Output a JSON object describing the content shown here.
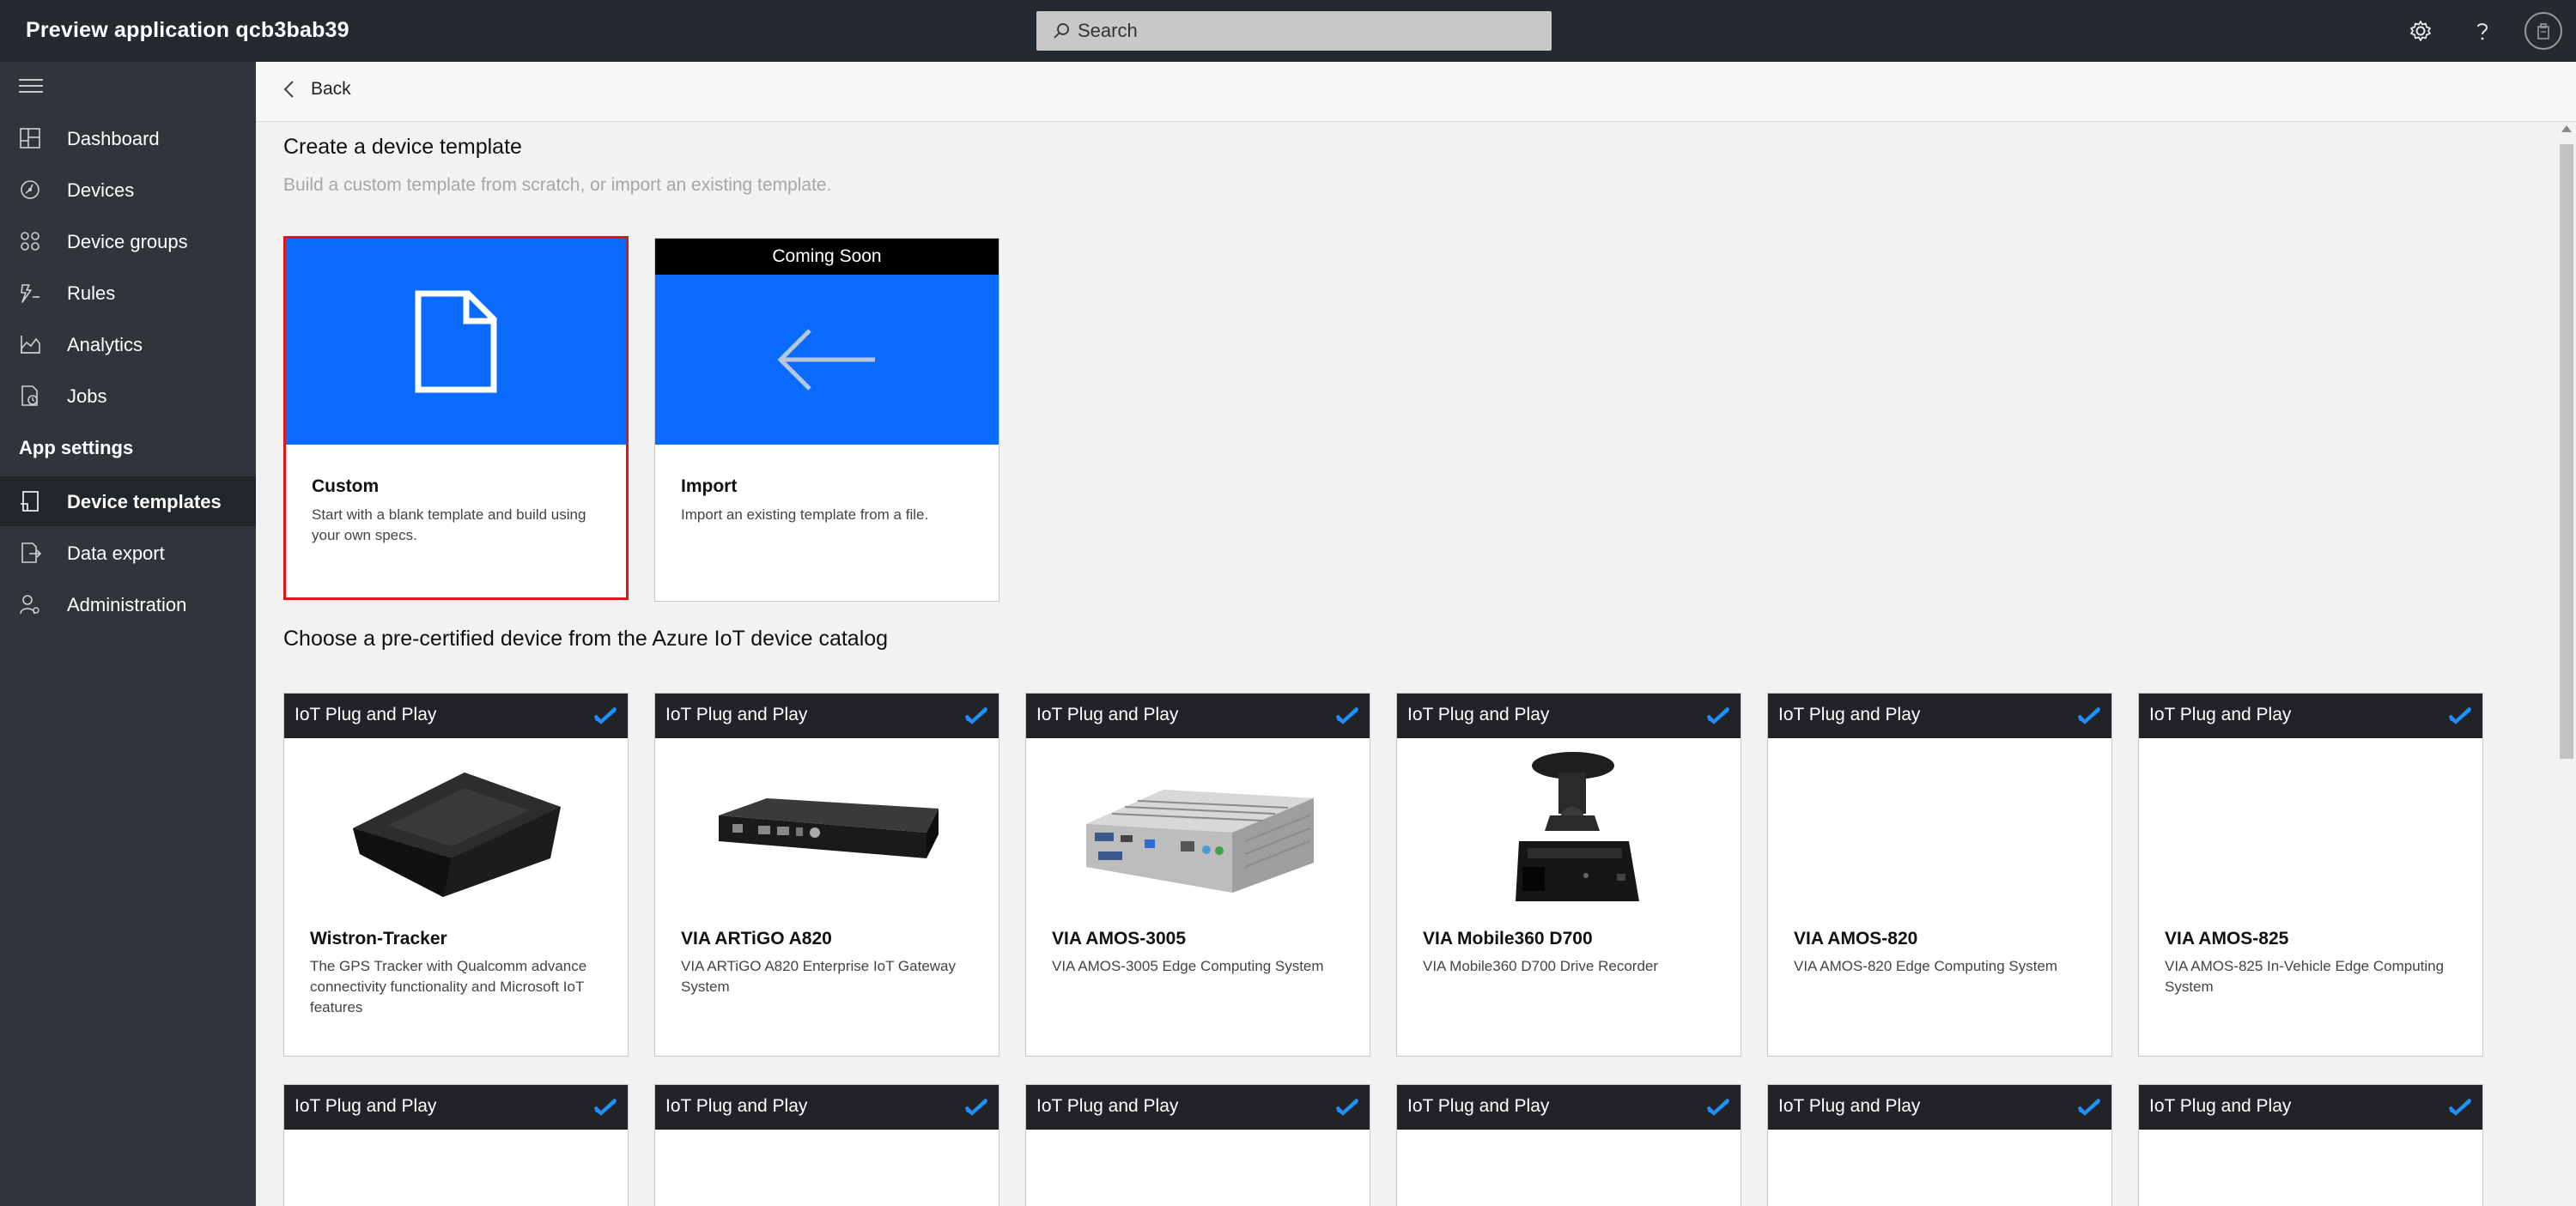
{
  "header": {
    "app_title": "Preview application qcb3bab39",
    "search_placeholder": "Search"
  },
  "sidebar": {
    "items": [
      {
        "label": "Dashboard",
        "icon": "dashboard-icon"
      },
      {
        "label": "Devices",
        "icon": "devices-icon"
      },
      {
        "label": "Device groups",
        "icon": "device-groups-icon"
      },
      {
        "label": "Rules",
        "icon": "rules-icon"
      },
      {
        "label": "Analytics",
        "icon": "analytics-icon"
      },
      {
        "label": "Jobs",
        "icon": "jobs-icon"
      }
    ],
    "section_label": "App settings",
    "settings_items": [
      {
        "label": "Device templates",
        "icon": "device-templates-icon",
        "active": true
      },
      {
        "label": "Data export",
        "icon": "data-export-icon"
      },
      {
        "label": "Administration",
        "icon": "administration-icon"
      }
    ]
  },
  "main": {
    "back_label": "Back",
    "title": "Create a device template",
    "subtitle": "Build a custom template from scratch, or import an existing template.",
    "templates": [
      {
        "title": "Custom",
        "description": "Start with a blank template and build using your own specs.",
        "selected": true
      },
      {
        "title": "Import",
        "description": "Import an existing template from a file.",
        "badge": "Coming Soon"
      }
    ],
    "catalog_title": "Choose a pre-certified device from the Azure IoT device catalog",
    "device_tag": "IoT Plug and Play",
    "devices": [
      {
        "name": "Wistron-Tracker",
        "description": "The GPS Tracker with Qualcomm advance connectivity functionality and Microsoft IoT features"
      },
      {
        "name": "VIA ARTiGO A820",
        "description": "VIA ARTiGO A820 Enterprise IoT Gateway System"
      },
      {
        "name": "VIA AMOS-3005",
        "description": "VIA AMOS-3005 Edge Computing System"
      },
      {
        "name": "VIA Mobile360 D700",
        "description": "VIA Mobile360 D700 Drive Recorder"
      },
      {
        "name": "VIA AMOS-820",
        "description": "VIA AMOS-820 Edge Computing System"
      },
      {
        "name": "VIA AMOS-825",
        "description": "VIA AMOS-825 In-Vehicle Edge Computing System"
      }
    ]
  },
  "colors": {
    "topbar": "#252a30",
    "sidebar": "#2f353b",
    "accent_blue": "#0a6cff",
    "selected_border": "#e0151c",
    "certified_check": "#1e90ff"
  }
}
